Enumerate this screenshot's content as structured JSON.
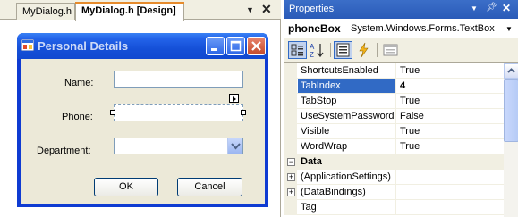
{
  "editor": {
    "tabs": [
      {
        "label": "MyDialog.h"
      },
      {
        "label": "MyDialog.h [Design]"
      }
    ]
  },
  "form": {
    "title": "Personal Details",
    "fields": {
      "name_label": "Name:",
      "phone_label": "Phone:",
      "department_label": "Department:"
    },
    "ok_label": "OK",
    "cancel_label": "Cancel"
  },
  "properties": {
    "title": "Properties",
    "object_name": "phoneBox",
    "object_type": "System.Windows.Forms.TextBox",
    "rows": [
      {
        "name": "ShortcutsEnabled",
        "value": "True"
      },
      {
        "name": "TabIndex",
        "value": "4"
      },
      {
        "name": "TabStop",
        "value": "True"
      },
      {
        "name": "UseSystemPasswordChar",
        "value": "False"
      },
      {
        "name": "Visible",
        "value": "True"
      },
      {
        "name": "WordWrap",
        "value": "True"
      },
      {
        "name": "Data",
        "value": ""
      },
      {
        "name": "(ApplicationSettings)",
        "value": ""
      },
      {
        "name": "(DataBindings)",
        "value": ""
      },
      {
        "name": "Tag",
        "value": ""
      }
    ]
  },
  "colors": {
    "accent": "#316ac5",
    "title_bar": "#0f3bd2",
    "tab_highlight": "#e68b2c"
  }
}
